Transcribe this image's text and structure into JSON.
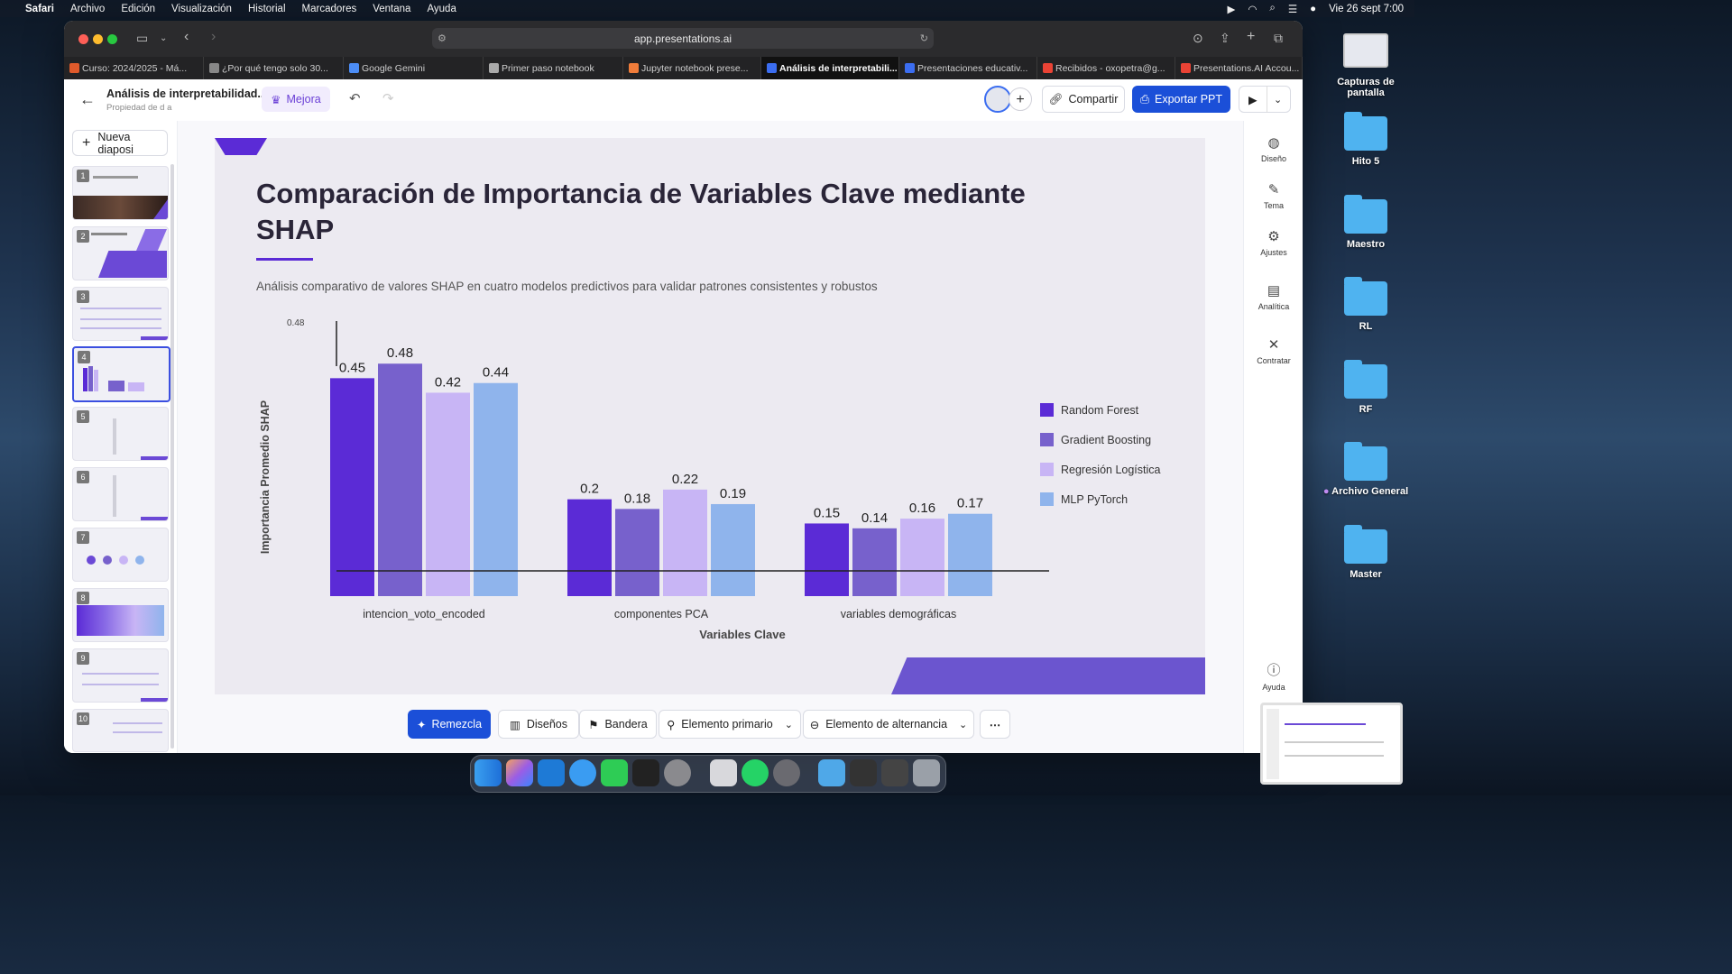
{
  "menubar": {
    "app": "Safari",
    "items": [
      "Archivo",
      "Edición",
      "Visualización",
      "Historial",
      "Marcadores",
      "Ventana",
      "Ayuda"
    ],
    "clock": "Vie 26 sept 7:00"
  },
  "browser": {
    "url": "app.presentations.ai",
    "tabs": [
      {
        "label": "Curso: 2024/2025 - Má...",
        "color": "#e05a2b"
      },
      {
        "label": "¿Por qué tengo solo 30...",
        "color": "#888888"
      },
      {
        "label": "Google Gemini",
        "color": "#4c8df6"
      },
      {
        "label": "Primer paso notebook",
        "color": "#aaaaaa"
      },
      {
        "label": "Jupyter notebook prese...",
        "color": "#f07c3a"
      },
      {
        "label": "Análisis de interpretabili...",
        "color": "#3b6df0"
      },
      {
        "label": "Presentaciones educativ...",
        "color": "#3b6df0"
      },
      {
        "label": "Recibidos - oxopetra@g...",
        "color": "#ea4335"
      },
      {
        "label": "Presentations.AI Accou...",
        "color": "#ea4335"
      }
    ]
  },
  "header": {
    "title": "Análisis de interpretabilidad...",
    "subtitle": "Propiedad de d a",
    "mejora": "Mejora",
    "share": "Compartir",
    "export": "Exportar PPT"
  },
  "sidebar": {
    "new_slide": "Nueva diaposi",
    "slides": [
      "1",
      "2",
      "3",
      "4",
      "5",
      "6",
      "7",
      "8",
      "9",
      "10"
    ]
  },
  "slide": {
    "title": "Comparación de Importancia de Variables Clave mediante SHAP",
    "subtitle": "Análisis comparativo de valores SHAP en cuatro modelos predictivos para validar patrones consistentes y robustos"
  },
  "chart_data": {
    "type": "bar",
    "categories": [
      "intencion_voto_encoded",
      "componentes PCA",
      "variables demográficas"
    ],
    "series": [
      {
        "name": "Random Forest",
        "values": [
          0.45,
          0.2,
          0.15
        ],
        "color": "#5b2bd6"
      },
      {
        "name": "Gradient Boosting",
        "values": [
          0.48,
          0.18,
          0.14
        ],
        "color": "#7761cc"
      },
      {
        "name": "Regresión Logística",
        "values": [
          0.42,
          0.22,
          0.16
        ],
        "color": "#c8b5f5"
      },
      {
        "name": "MLP PyTorch",
        "values": [
          0.44,
          0.19,
          0.17
        ],
        "color": "#8fb4ec"
      }
    ],
    "ytick": "0.48",
    "ylabel": "Importancia Promedio SHAP",
    "xlabel": "Variables Clave",
    "ylim": [
      0,
      0.5
    ],
    "legend": "right"
  },
  "rail": {
    "items": [
      {
        "label": "Diseño",
        "icon": "palette-icon"
      },
      {
        "label": "Tema",
        "icon": "brush-icon"
      },
      {
        "label": "Ajustes",
        "icon": "gear-icon"
      },
      {
        "label": "Analítica",
        "icon": "analytics-icon"
      },
      {
        "label": "Contratar",
        "icon": "tools-icon"
      }
    ],
    "help": "Ayuda"
  },
  "toolbar": {
    "remix": "Remezcla",
    "designs": "Diseños",
    "flag": "Bandera",
    "primary": "Elemento primario",
    "toggle": "Elemento de alternancia"
  },
  "desktop": {
    "icons": [
      "Capturas de pantalla",
      "Hito 5",
      "Maestro",
      "RL",
      "RF",
      "Archivo General",
      "Master"
    ]
  }
}
